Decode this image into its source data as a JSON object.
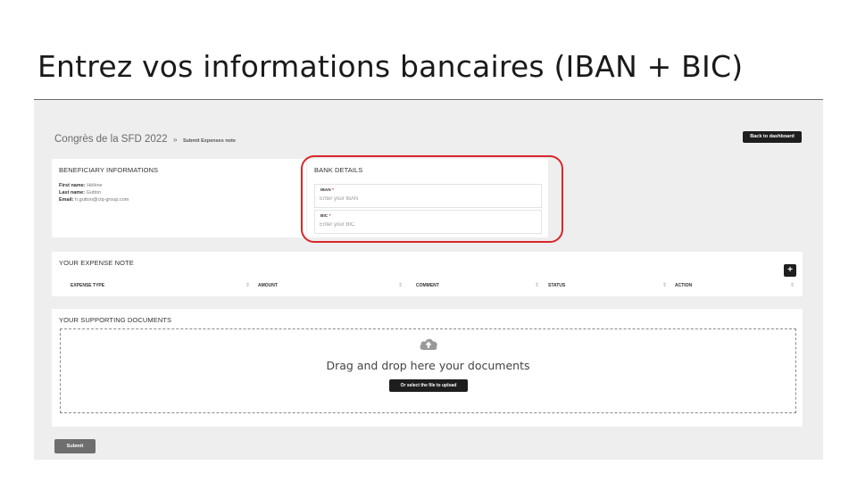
{
  "slide": {
    "title": "Entrez vos informations bancaires (IBAN + BIC)"
  },
  "header": {
    "event_title": "Congrès de la SFD 2022",
    "separator": "»",
    "page_title": "Submit Expenses note",
    "back_button": "Back to dashboard"
  },
  "beneficiary": {
    "title": "BENEFICIARY INFORMATIONS",
    "first_name_label": "First name:",
    "first_name": "Hélène",
    "last_name_label": "Last name:",
    "last_name": "Gutton",
    "email_label": "Email:",
    "email": "h.gutton@clq-group.com"
  },
  "bank": {
    "title": "BANK DETAILS",
    "iban_label": "IBAN",
    "iban_placeholder": "Enter your IBAN",
    "iban_value": "",
    "bic_label": "BIC",
    "bic_placeholder": "Enter your BIC",
    "bic_value": "",
    "required_marker": "*"
  },
  "expense_note": {
    "title": "YOUR EXPENSE NOTE",
    "add_button": "+",
    "columns": [
      "EXPENSE TYPE",
      "AMOUNT",
      "COMMENT",
      "STATUS",
      "ACTION"
    ],
    "rows": []
  },
  "documents": {
    "title": "YOUR SUPPORTING DOCUMENTS",
    "drop_text": "Drag and drop here your documents",
    "select_button": "Or select the file to upload"
  },
  "footer": {
    "submit_button": "Submit"
  },
  "colors": {
    "highlight": "#d9262b",
    "button_dark": "#1e1e1e",
    "submit_button": "#6e6e6e",
    "background": "#eeeeee"
  }
}
